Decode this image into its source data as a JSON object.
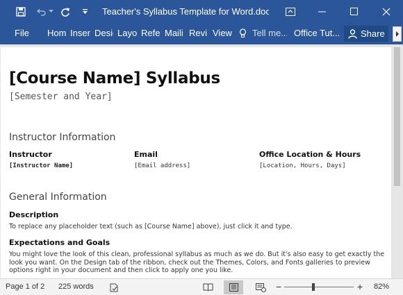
{
  "titlebar": {
    "title": "Teacher's Syllabus Template for Word.docx...",
    "icons": [
      "save-icon",
      "undo-icon",
      "undo-dropdown-icon",
      "redo-icon",
      "customize-qat-icon",
      "ribbon-display-icon",
      "minimize-icon",
      "maximize-icon",
      "close-icon"
    ]
  },
  "tabs": {
    "file": "File",
    "home": "Hom",
    "insert": "Inser",
    "design": "Desig",
    "layout": "Layo",
    "references": "Refer",
    "mailings": "Maili",
    "review": "Revi",
    "view": "View",
    "tell_me": "Tell me...",
    "office_tutorials": "Office Tut...",
    "share": "Share"
  },
  "document": {
    "title": "[Course Name] Syllabus",
    "semester": "[Semester and Year]",
    "instructor_section": "Instructor Information",
    "columns": [
      {
        "label": "Instructor",
        "value": "[Instructor Name]"
      },
      {
        "label": "Email",
        "value": "[Email address]"
      },
      {
        "label": "Office Location & Hours",
        "value": "[Location, Hours, Days]"
      }
    ],
    "general_section": "General Information",
    "description_label": "Description",
    "description_text": "To replace any placeholder text (such as [Course Name] above), just click it and type.",
    "expectations_label": "Expectations and Goals",
    "expectations_text": "You might love the look of this clean, professional syllabus as much as we do. But it's also easy to get exactly the look you want. On the Design tab of the ribbon, check out the Themes, Colors, and Fonts galleries to preview options right in your document and then click to apply one you like."
  },
  "statusbar": {
    "page": "Page 1 of 2",
    "words": "225 words",
    "zoom": "82%",
    "zoom_level": 0.82
  },
  "colors": {
    "ribbon": "#2b579a",
    "status_bg": "#f3f3f3"
  }
}
